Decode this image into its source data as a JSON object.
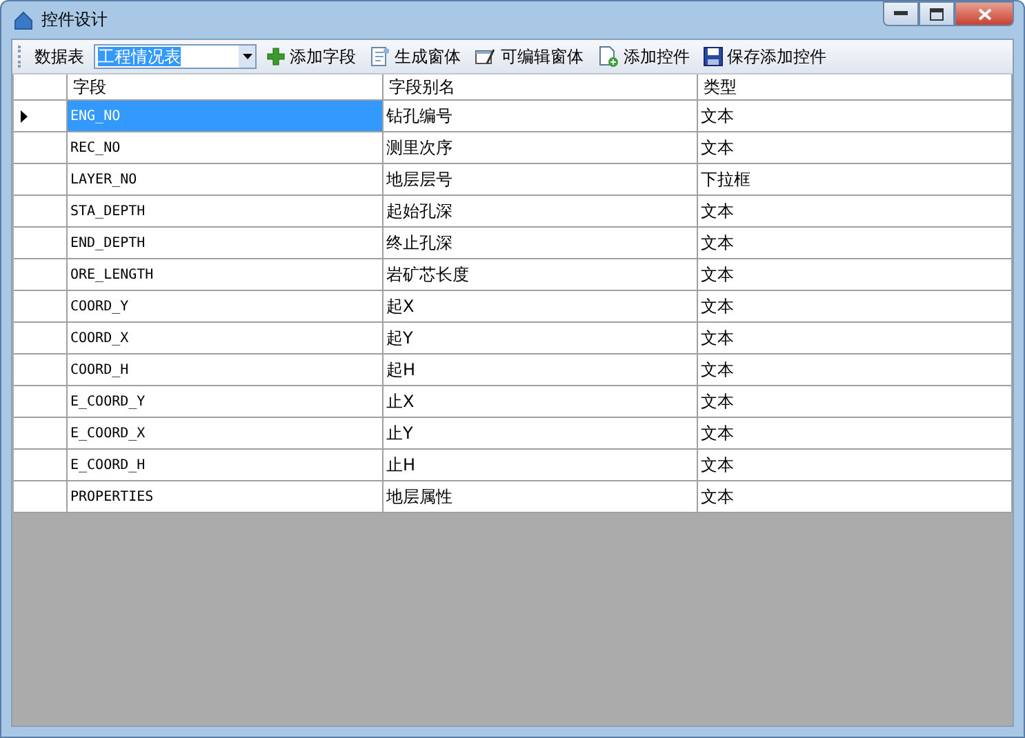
{
  "window": {
    "title": "控件设计"
  },
  "toolbar": {
    "table_label": "数据表",
    "table_combo": {
      "value": "工程情况表"
    },
    "items": [
      {
        "kind": "add",
        "label": "添加字段"
      },
      {
        "kind": "form",
        "label": "生成窗体"
      },
      {
        "kind": "edit",
        "label": "可编辑窗体"
      },
      {
        "kind": "control",
        "label": "添加控件"
      },
      {
        "kind": "save",
        "label": "保存添加控件"
      }
    ]
  },
  "table": {
    "columns": [
      "字段",
      "字段别名",
      "类型"
    ],
    "rows": [
      {
        "field": "ENG_NO",
        "alias": "钻孔编号",
        "type": "文本",
        "selected": true
      },
      {
        "field": "REC_NO",
        "alias": "测里次序",
        "type": "文本",
        "selected": false
      },
      {
        "field": "LAYER_NO",
        "alias": "地层层号",
        "type": "下拉框",
        "selected": false
      },
      {
        "field": "STA_DEPTH",
        "alias": "起始孔深",
        "type": "文本",
        "selected": false
      },
      {
        "field": "END_DEPTH",
        "alias": "终止孔深",
        "type": "文本",
        "selected": false
      },
      {
        "field": "ORE_LENGTH",
        "alias": "岩矿芯长度",
        "type": "文本",
        "selected": false
      },
      {
        "field": "COORD_Y",
        "alias": "起X",
        "type": "文本",
        "selected": false
      },
      {
        "field": "COORD_X",
        "alias": "起Y",
        "type": "文本",
        "selected": false
      },
      {
        "field": "COORD_H",
        "alias": "起H",
        "type": "文本",
        "selected": false
      },
      {
        "field": "E_COORD_Y",
        "alias": "止X",
        "type": "文本",
        "selected": false
      },
      {
        "field": "E_COORD_X",
        "alias": "止Y",
        "type": "文本",
        "selected": false
      },
      {
        "field": "E_COORD_H",
        "alias": "止H",
        "type": "文本",
        "selected": false
      },
      {
        "field": "PROPERTIES",
        "alias": "地层属性",
        "type": "文本",
        "selected": false
      }
    ]
  }
}
